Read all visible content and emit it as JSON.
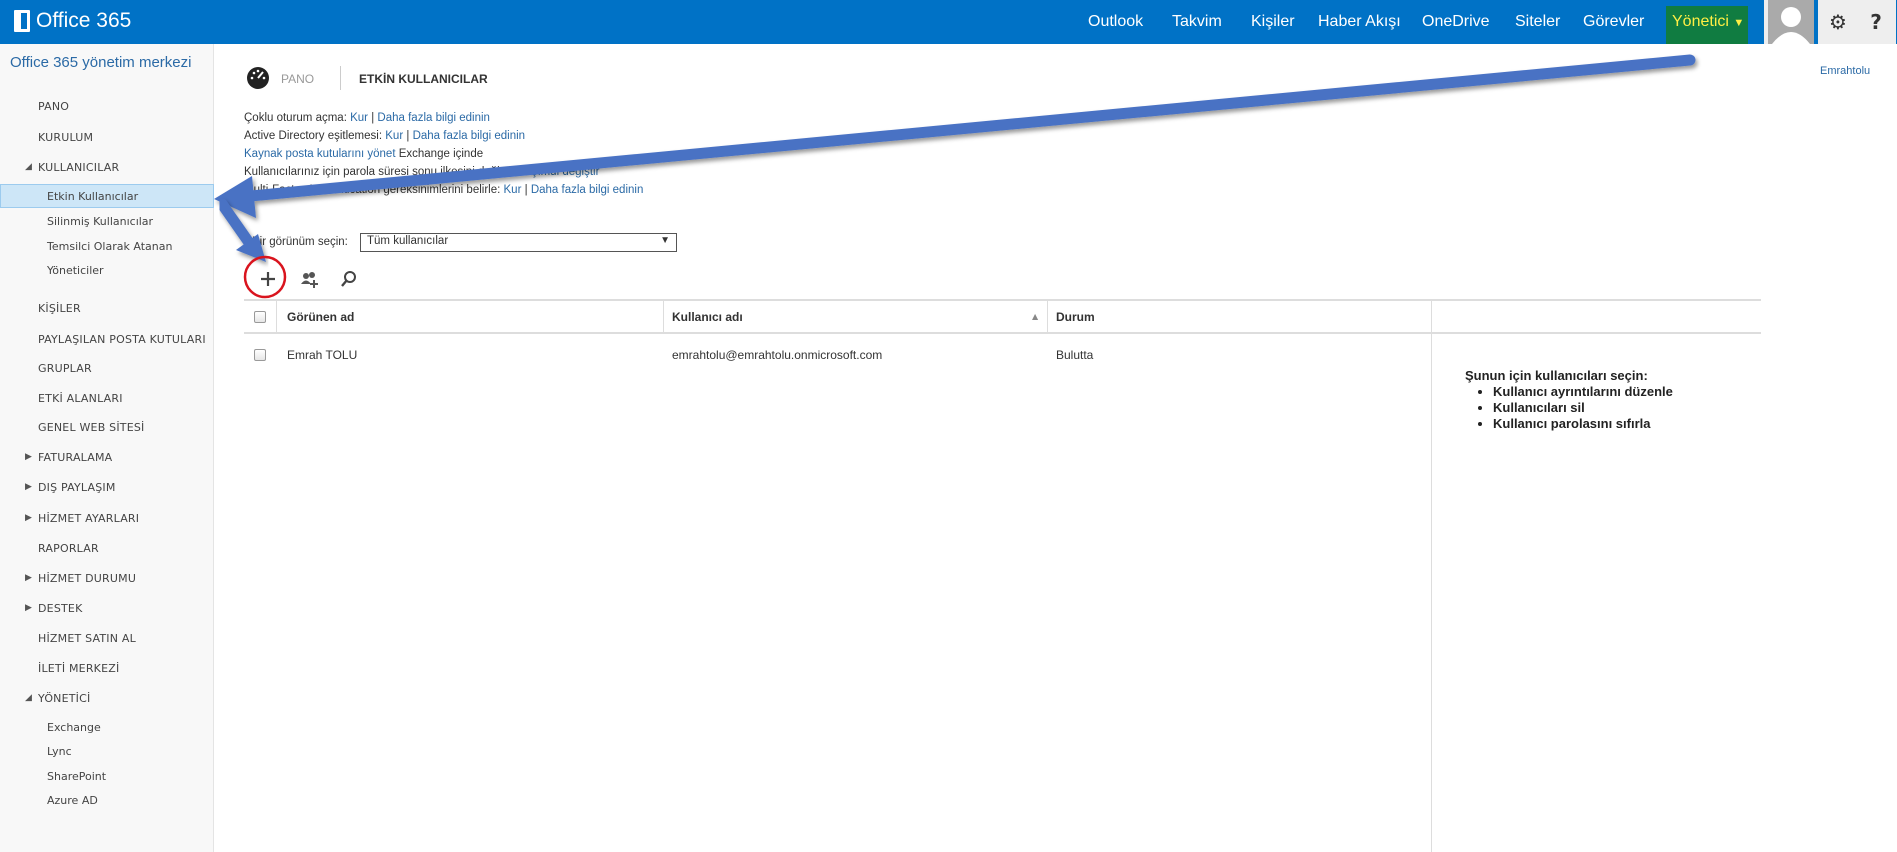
{
  "topbar": {
    "logo": "Office 365",
    "nav": [
      "Outlook",
      "Takvim",
      "Kişiler",
      "Haber Akışı",
      "OneDrive",
      "Siteler",
      "Görevler"
    ],
    "admin": "Yönetici",
    "settings_icon": "gear-icon",
    "help": "?",
    "user": "Emrahtolu",
    "accent": "#0072c6",
    "admin_color": "#107c41"
  },
  "sidebar": {
    "title": "Office 365 yönetim merkezi",
    "items": [
      {
        "label": "PANO"
      },
      {
        "label": "KURULUM"
      },
      {
        "label": "KULLANICILAR",
        "expanded": true,
        "children": [
          "Etkin Kullanıcılar",
          "Silinmiş Kullanıcılar",
          "Temsilci Olarak Atanan",
          "Yöneticiler"
        ]
      },
      {
        "label": "KİŞİLER"
      },
      {
        "label": "PAYLAŞILAN POSTA KUTULARI"
      },
      {
        "label": "GRUPLAR"
      },
      {
        "label": "ETKİ ALANLARI"
      },
      {
        "label": "GENEL WEB SİTESİ"
      },
      {
        "label": "FATURALAMA",
        "collapsed": true
      },
      {
        "label": "DIŞ PAYLAŞIM",
        "collapsed": true
      },
      {
        "label": "HİZMET AYARLARI",
        "collapsed": true
      },
      {
        "label": "RAPORLAR"
      },
      {
        "label": "HİZMET DURUMU",
        "collapsed": true
      },
      {
        "label": "DESTEK",
        "collapsed": true
      },
      {
        "label": "HİZMET SATIN AL"
      },
      {
        "label": "İLETİ MERKEZİ"
      },
      {
        "label": "YÖNETİCİ",
        "expanded": true,
        "children": [
          "Exchange",
          "Lync",
          "SharePoint",
          "Azure AD"
        ]
      }
    ],
    "active": "Etkin Kullanıcılar"
  },
  "header": {
    "breadcrumb_home": "PANO",
    "title": "ETKİN KULLANICILAR"
  },
  "info": {
    "sso_label": "Çoklu oturum açma:",
    "kur": "Kur",
    "sep": "|",
    "learn": "Daha fazla bilgi edinin",
    "ad_label": "Active Directory eşitlemesi:",
    "mailbox_link": "Kaynak posta kutularını yönet",
    "mailbox_suffix": "Exchange içinde",
    "pwd_label": "Kullanıcılarınız için parola süresi sonu ilkesini değiştirin:",
    "pwd_link": "Şimdi değiştir",
    "mfa_label": "Multi-Factor Authentication gereksinimlerini belirle:"
  },
  "view": {
    "label": "Bir görünüm seçin:",
    "selected": "Tüm kullanıcılar"
  },
  "table": {
    "columns": [
      "Görünen ad",
      "Kullanıcı adı",
      "Durum"
    ],
    "sort_indicator": "▲",
    "rows": [
      {
        "name": "Emrah TOLU",
        "username": "emrahtolu@emrahtolu.onmicrosoft.com",
        "status": "Bulutta"
      }
    ]
  },
  "panel": {
    "heading": "Şunun için kullanıcıları seçin:",
    "items": [
      "Kullanıcı ayrıntılarını düzenle",
      "Kullanıcıları sil",
      "Kullanıcı parolasını sıfırla"
    ]
  },
  "annotation_color": "#4a72c4"
}
